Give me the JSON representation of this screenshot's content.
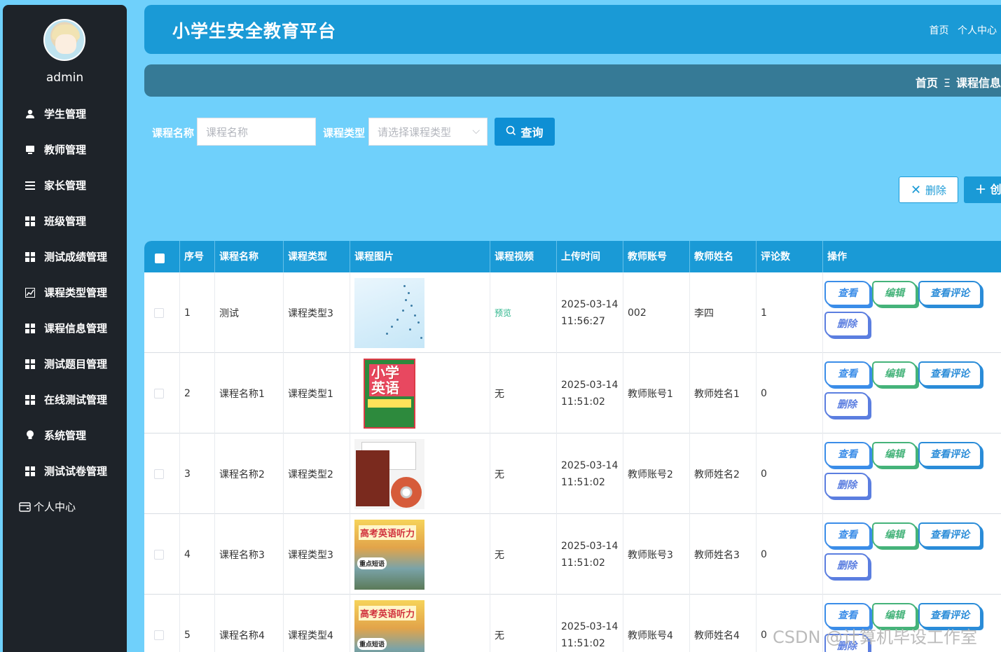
{
  "app": {
    "title": "小学生安全教育平台",
    "header_links": [
      "首页",
      "个人中心"
    ]
  },
  "sidebar": {
    "username": "admin",
    "items": [
      {
        "label": "学生管理",
        "icon": "user-icon"
      },
      {
        "label": "教师管理",
        "icon": "chalkboard-icon"
      },
      {
        "label": "家长管理",
        "icon": "list-icon"
      },
      {
        "label": "班级管理",
        "icon": "grid-icon"
      },
      {
        "label": "测试成绩管理",
        "icon": "grid-icon"
      },
      {
        "label": "课程类型管理",
        "icon": "chart-icon"
      },
      {
        "label": "课程信息管理",
        "icon": "grid-icon"
      },
      {
        "label": "测试题目管理",
        "icon": "grid-icon"
      },
      {
        "label": "在线测试管理",
        "icon": "grid-icon"
      },
      {
        "label": "系统管理",
        "icon": "bulb-icon"
      },
      {
        "label": "测试试卷管理",
        "icon": "grid-icon"
      },
      {
        "label": "个人中心",
        "icon": "wallet-icon"
      }
    ]
  },
  "breadcrumb": {
    "home": "首页",
    "sep": "Ξ",
    "current": "课程信息"
  },
  "search": {
    "name_label": "课程名称",
    "name_placeholder": "课程名称",
    "type_label": "课程类型",
    "type_placeholder": "请选择课程类型",
    "query_label": "查询"
  },
  "actions": {
    "delete_label": "删除",
    "create_label": "创"
  },
  "table": {
    "headers": [
      "序号",
      "课程名称",
      "课程类型",
      "课程图片",
      "课程视频",
      "上传时间",
      "教师账号",
      "教师姓名",
      "评论数",
      "操作"
    ],
    "rows": [
      {
        "index": "1",
        "name": "测试",
        "type": "课程类型3",
        "video": "预览",
        "time": "2025-03-14 11:56:27",
        "account": "002",
        "teacher": "李四",
        "comments": "1"
      },
      {
        "index": "2",
        "name": "课程名称1",
        "type": "课程类型1",
        "video": "无",
        "time": "2025-03-14 11:51:02",
        "account": "教师账号1",
        "teacher": "教师姓名1",
        "comments": "0"
      },
      {
        "index": "3",
        "name": "课程名称2",
        "type": "课程类型2",
        "video": "无",
        "time": "2025-03-14 11:51:02",
        "account": "教师账号2",
        "teacher": "教师姓名2",
        "comments": "0"
      },
      {
        "index": "4",
        "name": "课程名称3",
        "type": "课程类型3",
        "video": "无",
        "time": "2025-03-14 11:51:02",
        "account": "教师账号3",
        "teacher": "教师姓名3",
        "comments": "0"
      },
      {
        "index": "5",
        "name": "课程名称4",
        "type": "课程类型4",
        "video": "无",
        "time": "2025-03-14 11:51:02",
        "account": "教师账号4",
        "teacher": "教师姓名4",
        "comments": "0"
      }
    ],
    "row_ops": {
      "view": "查看",
      "edit": "编辑",
      "comment": "查看评论",
      "delete": "删除"
    },
    "image_texts": {
      "book2": "小学英语",
      "book4": "高考英语听力",
      "book4_badge": "重点短语"
    }
  },
  "watermark": "CSDN @计算机毕设工作室",
  "colors": {
    "primary": "#1a9ad6",
    "sidebar": "#1e2329",
    "background": "#6fd0fb",
    "crumbbar": "#367a96"
  }
}
